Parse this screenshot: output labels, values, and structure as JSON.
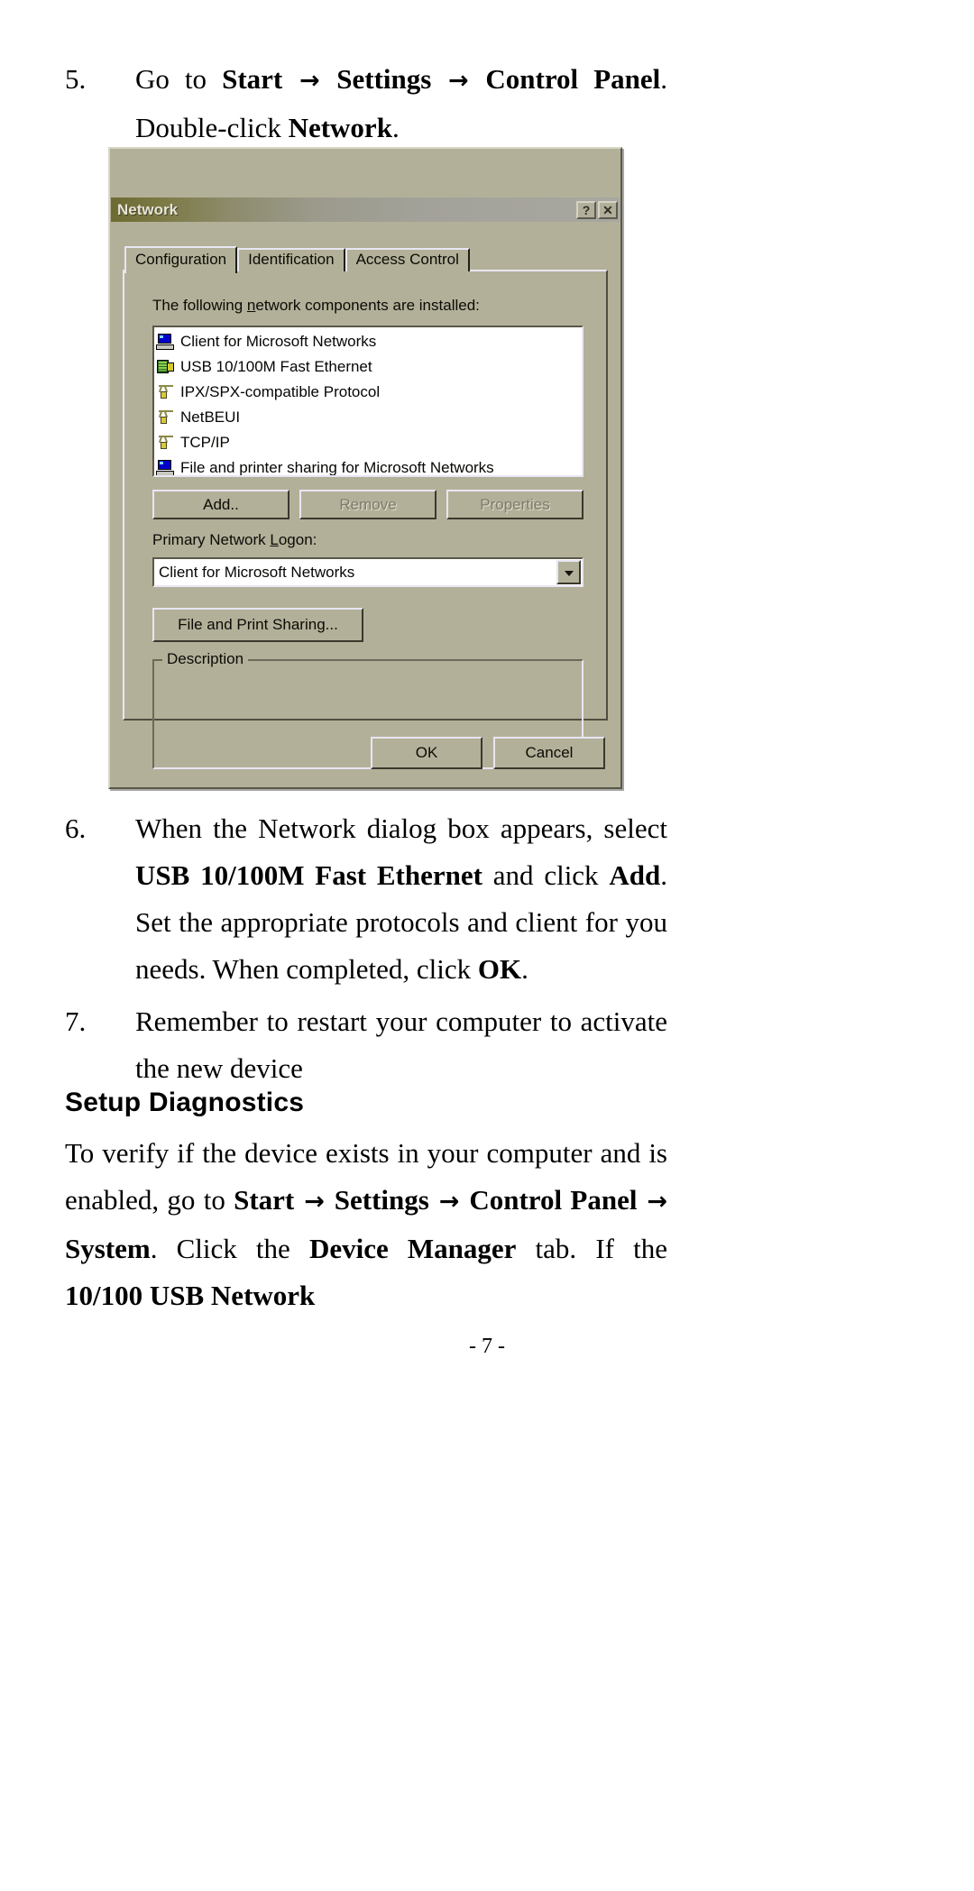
{
  "document": {
    "steps": [
      {
        "number": "5.",
        "segments": [
          {
            "t": "Go to ",
            "b": false
          },
          {
            "t": "Start",
            "b": true
          },
          {
            "t": " → ",
            "b": true
          },
          {
            "t": "Settings",
            "b": true
          },
          {
            "t": " → ",
            "b": true
          },
          {
            "t": "Control Panel",
            "b": true
          },
          {
            "t": ". Double-click ",
            "b": false
          },
          {
            "t": "Network",
            "b": true
          },
          {
            "t": ".",
            "b": false
          }
        ]
      },
      {
        "number": "6.",
        "segments": [
          {
            "t": "When the Network dialog box appears, select ",
            "b": false
          },
          {
            "t": "USB 10/100M Fast Ethernet",
            "b": true
          },
          {
            "t": " and click ",
            "b": false
          },
          {
            "t": "Add",
            "b": true
          },
          {
            "t": ". Set the appropriate protocols and client for you needs. When completed, click ",
            "b": false
          },
          {
            "t": "OK",
            "b": true
          },
          {
            "t": ".",
            "b": false
          }
        ]
      },
      {
        "number": "7.",
        "segments": [
          {
            "t": "Remember to restart your computer to activate the new device",
            "b": false
          }
        ]
      }
    ],
    "section_title": "Setup Diagnostics",
    "paragraph": [
      {
        "t": "To verify if the device exists in your computer and is enabled, go to ",
        "b": false
      },
      {
        "t": "Start",
        "b": true
      },
      {
        "t": " → ",
        "b": true
      },
      {
        "t": "Settings",
        "b": true
      },
      {
        "t": " → ",
        "b": true
      },
      {
        "t": "Control Panel",
        "b": true
      },
      {
        "t": " → ",
        "b": true
      },
      {
        "t": "System",
        "b": true
      },
      {
        "t": ". Click the ",
        "b": false
      },
      {
        "t": "Device Manager",
        "b": true
      },
      {
        "t": " tab. If the ",
        "b": false
      },
      {
        "t": "10/100 USB Network",
        "b": true
      }
    ],
    "footer": "- 7 -"
  },
  "dialog": {
    "title": "Network",
    "titlebar_buttons": [
      {
        "name": "help-button",
        "glyph": "?"
      },
      {
        "name": "close-button",
        "glyph": "✕"
      }
    ],
    "tabs": [
      {
        "label": "Configuration",
        "active": true
      },
      {
        "label": "Identification",
        "active": false
      },
      {
        "label": "Access Control",
        "active": false
      }
    ],
    "list_label_pre": "The following ",
    "list_label_accel": "n",
    "list_label_post": "etwork components are installed:",
    "components": [
      {
        "label": "Client for Microsoft Networks",
        "icon": "computer-icon"
      },
      {
        "label": "USB 10/100M Fast Ethernet",
        "icon": "network-card-icon"
      },
      {
        "label": "IPX/SPX-compatible Protocol",
        "icon": "protocol-icon"
      },
      {
        "label": "NetBEUI",
        "icon": "protocol-icon"
      },
      {
        "label": "TCP/IP",
        "icon": "protocol-icon"
      },
      {
        "label": "File and printer sharing for Microsoft Networks",
        "icon": "computer-icon"
      }
    ],
    "buttons": {
      "add": "Add..",
      "remove": "Remove",
      "properties": "Properties",
      "file_print_sharing": "File and Print Sharing...",
      "ok": "OK",
      "cancel": "Cancel"
    },
    "primary_logon_label_pre": "Primary Network ",
    "primary_logon_label_accel": "L",
    "primary_logon_label_post": "ogon:",
    "primary_logon_value": "Client for Microsoft Networks",
    "description_legend": "Description",
    "description_text": "",
    "colors": {
      "face": "#b3b099",
      "title_left": "#6d6b33",
      "title_right": "#a8a7a0",
      "highlight": "#e8e6f2",
      "shadow": "#4f4d3f"
    }
  }
}
